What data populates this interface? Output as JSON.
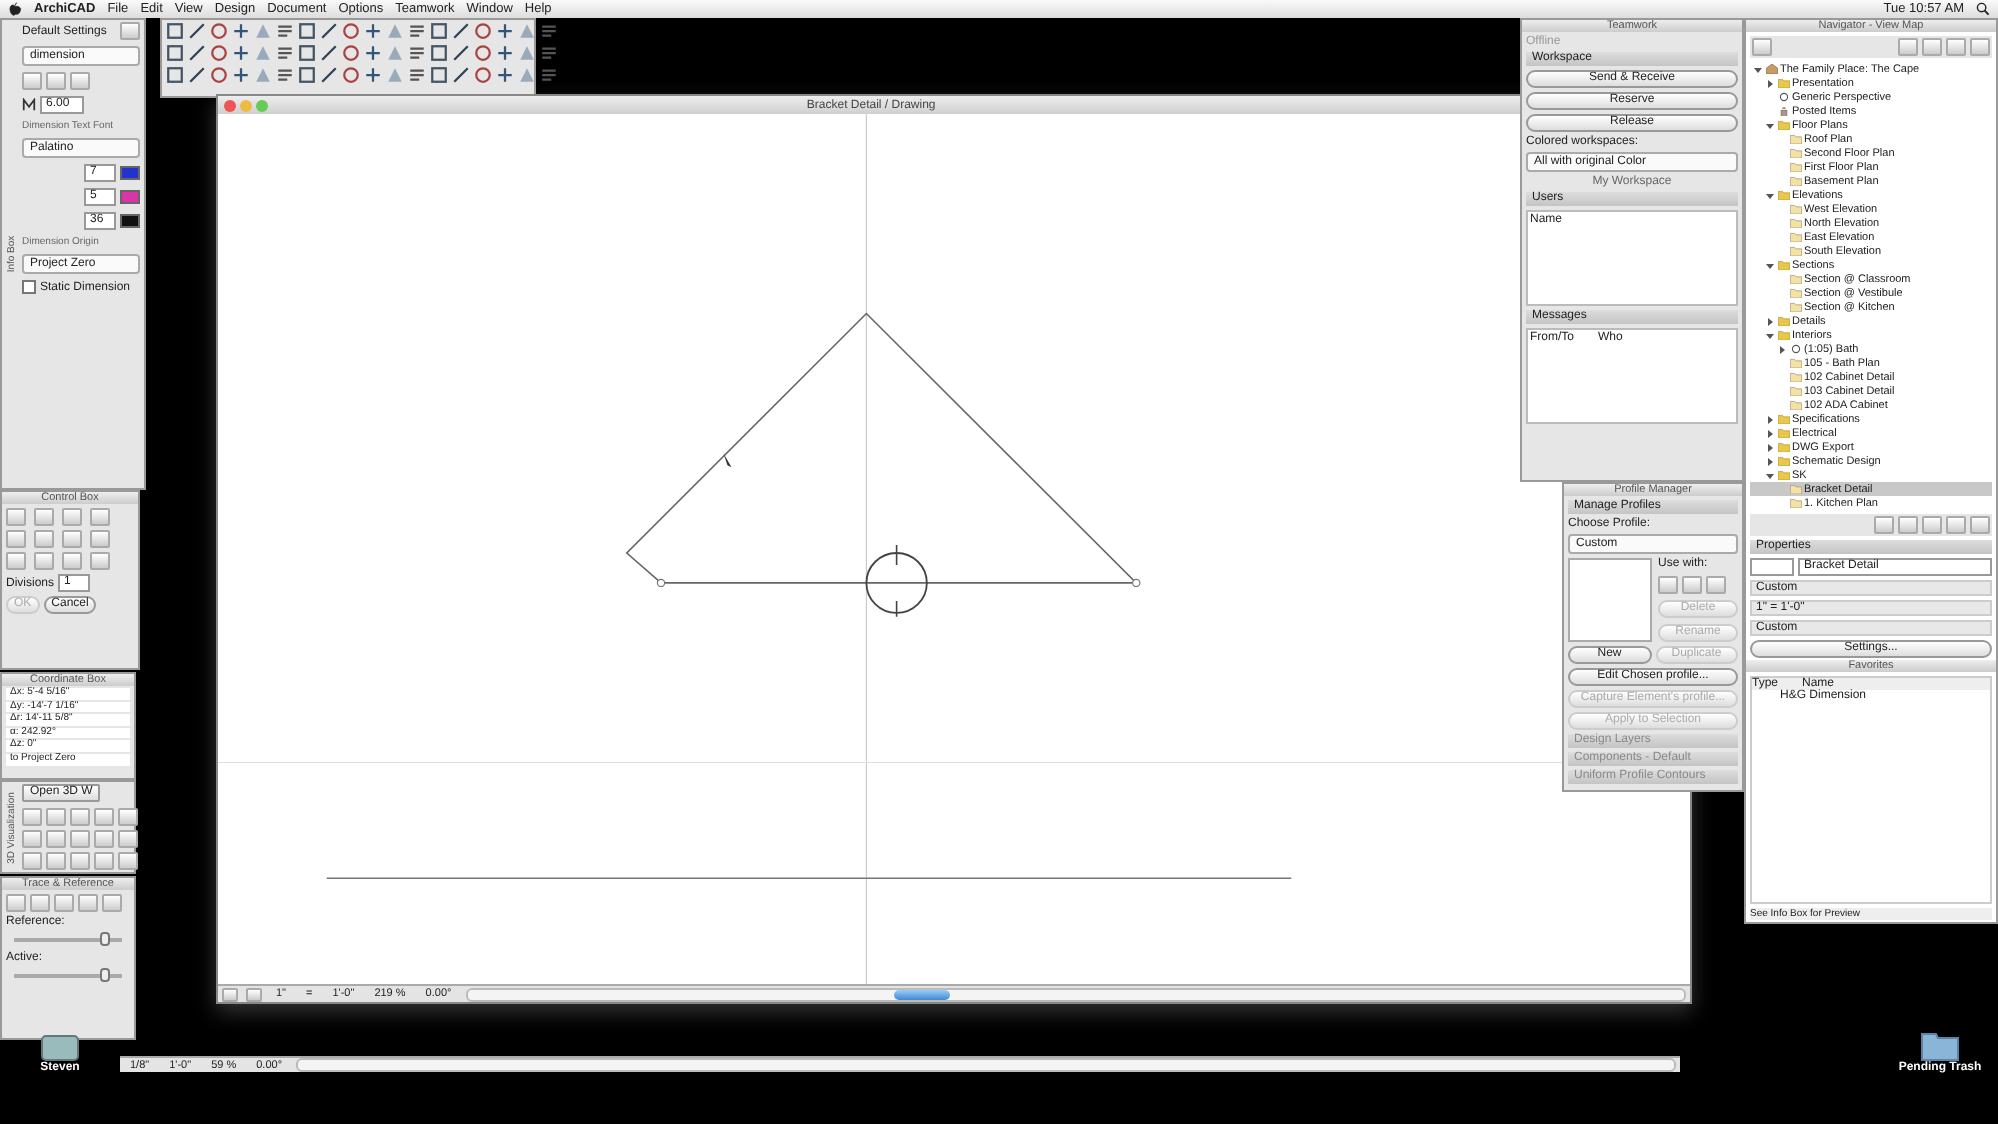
{
  "menu_bar": {
    "app": "ArchiCAD",
    "items": [
      "File",
      "Edit",
      "View",
      "Design",
      "Document",
      "Options",
      "Teamwork",
      "Window",
      "Help"
    ],
    "clock": "Tue 10:57 AM"
  },
  "info_box": {
    "side_label": "Info Box",
    "default_settings": "Default Settings",
    "tool_name": "dimension",
    "text_size": "6.00",
    "font_label": "Dimension Text Font",
    "font": "Palatino",
    "pen_values": [
      "7",
      "5",
      "36"
    ],
    "origin_label": "Dimension Origin",
    "origin": "Project Zero",
    "static": {
      "label": "Static Dimension",
      "checked": false
    }
  },
  "control_box": {
    "title": "Control Box",
    "divisions_label": "Divisions",
    "divisions_value": "1",
    "buttons": [
      {
        "label": "OK",
        "disabled": true
      },
      {
        "label": "Cancel",
        "disabled": false
      }
    ]
  },
  "coordinate_box": {
    "title": "Coordinate Box",
    "rows": [
      "Δx: 5'-4 5/16\"",
      "Δy: -14'-7 1/16\"",
      "Δr: 14'-11 5/8\"",
      "α: 242.92°",
      "Δz: 0\"",
      "to Project Zero"
    ]
  },
  "visualization": {
    "side_label": "3D Visualization",
    "button": "Open 3D W"
  },
  "trace": {
    "title": "Trace & Reference",
    "reference_label": "Reference:",
    "active_label": "Active:",
    "reference_slider": {
      "level": 0.85
    },
    "active_slider": {
      "level": 0.85
    }
  },
  "drawing_window": {
    "title": "Bracket Detail / Drawing",
    "status": [
      "1\"",
      "=",
      "1'-0\"",
      "219 %",
      "0.00°"
    ]
  },
  "back_window_status": [
    "1/8\"",
    "1'-0\"",
    "59 %",
    "0.00°"
  ],
  "teamwork": {
    "title": "Teamwork",
    "status": "Offline",
    "workspace_header": "Workspace",
    "buttons": [
      "Send & Receive",
      "Reserve",
      "Release"
    ],
    "colored_label": "Colored workspaces:",
    "colored_value": "All with original Color",
    "my_workspace": "My Workspace",
    "users_header": "Users",
    "users_column": "Name",
    "messages_header": "Messages",
    "message_columns": [
      "From/To",
      "Who"
    ]
  },
  "profile_manager": {
    "title": "Profile Manager",
    "header": "Manage Profiles",
    "choose_label": "Choose Profile:",
    "profile": "Custom",
    "use_with_label": "Use with:",
    "buttons": [
      {
        "label": "Delete",
        "disabled": true
      },
      {
        "label": "Rename",
        "disabled": true
      },
      {
        "label": "New",
        "disabled": false
      },
      {
        "label": "Duplicate",
        "disabled": true
      },
      {
        "label": "Edit Chosen profile...",
        "disabled": false
      },
      {
        "label": "Capture Element's profile...",
        "disabled": true
      },
      {
        "label": "Apply to Selection",
        "disabled": true
      }
    ],
    "sections": [
      "Design Layers",
      "Components - Default",
      "Uniform Profile Contours"
    ]
  },
  "navigator": {
    "title": "Navigator - View Map",
    "tree": [
      {
        "label": "The Family Place: The Cape",
        "kind": "project",
        "expanded": true,
        "selected": false,
        "children": [
          {
            "label": "Presentation",
            "kind": "folder",
            "expanded": false,
            "selected": false
          },
          {
            "label": "Generic Perspective",
            "kind": "perspective",
            "selected": false
          },
          {
            "label": "Posted Items",
            "kind": "posted",
            "selected": false
          },
          {
            "label": "Floor Plans",
            "kind": "folder",
            "expanded": true,
            "selected": false,
            "children": [
              {
                "label": "Roof Plan",
                "kind": "view",
                "selected": false
              },
              {
                "label": "Second Floor Plan",
                "kind": "view",
                "selected": false
              },
              {
                "label": "First Floor Plan",
                "kind": "view",
                "selected": false
              },
              {
                "label": "Basement Plan",
                "kind": "view",
                "selected": false
              }
            ]
          },
          {
            "label": "Elevations",
            "kind": "folder",
            "expanded": true,
            "selected": false,
            "children": [
              {
                "label": "West Elevation",
                "kind": "view",
                "selected": false
              },
              {
                "label": "North Elevation",
                "kind": "view",
                "selected": false
              },
              {
                "label": "East Elevation",
                "kind": "view",
                "selected": false
              },
              {
                "label": "South Elevation",
                "kind": "view",
                "selected": false
              }
            ]
          },
          {
            "label": "Sections",
            "kind": "folder",
            "expanded": true,
            "selected": false,
            "children": [
              {
                "label": "Section @ Classroom",
                "kind": "view",
                "selected": false
              },
              {
                "label": "Section @ Vestibule",
                "kind": "view",
                "selected": false
              },
              {
                "label": "Section @ Kitchen",
                "kind": "view",
                "selected": false
              }
            ]
          },
          {
            "label": "Details",
            "kind": "folder",
            "expanded": false,
            "selected": false
          },
          {
            "label": "Interiors",
            "kind": "folder",
            "expanded": true,
            "selected": false,
            "children": [
              {
                "label": "(1:05) Bath",
                "kind": "camera",
                "expanded": false,
                "selected": false
              },
              {
                "label": "105 - Bath Plan",
                "kind": "view",
                "selected": false
              },
              {
                "label": "102 Cabinet Detail",
                "kind": "view",
                "selected": false
              },
              {
                "label": "103 Cabinet Detail",
                "kind": "view",
                "selected": false
              },
              {
                "label": "102 ADA Cabinet",
                "kind": "view",
                "selected": false
              }
            ]
          },
          {
            "label": "Specifications",
            "kind": "folder",
            "expanded": false,
            "selected": false
          },
          {
            "label": "Electrical",
            "kind": "folder",
            "expanded": false,
            "selected": false
          },
          {
            "label": "DWG Export",
            "kind": "folder",
            "expanded": false,
            "selected": false
          },
          {
            "label": "Schematic Design",
            "kind": "folder",
            "expanded": false,
            "selected": false
          },
          {
            "label": "SK",
            "kind": "folder",
            "expanded": true,
            "selected": false,
            "children": [
              {
                "label": "Bracket Detail",
                "kind": "view",
                "selected": true
              },
              {
                "label": "1. Kitchen Plan",
                "kind": "view",
                "selected": false
              }
            ]
          }
        ]
      }
    ]
  },
  "properties": {
    "header": "Properties",
    "name": "Bracket Detail",
    "rows": [
      "Custom",
      "1\"  =  1'-0\"",
      "Custom"
    ],
    "settings": "Settings..."
  },
  "favorites": {
    "title": "Favorites",
    "columns": [
      "Type",
      "Name"
    ],
    "items": [
      "H&G Dimension"
    ],
    "hint": "See Info Box for Preview"
  },
  "desktop_icons": [
    {
      "label": "Steven",
      "kind": "drive"
    },
    {
      "label": "Pending Trash",
      "kind": "folder"
    }
  ]
}
